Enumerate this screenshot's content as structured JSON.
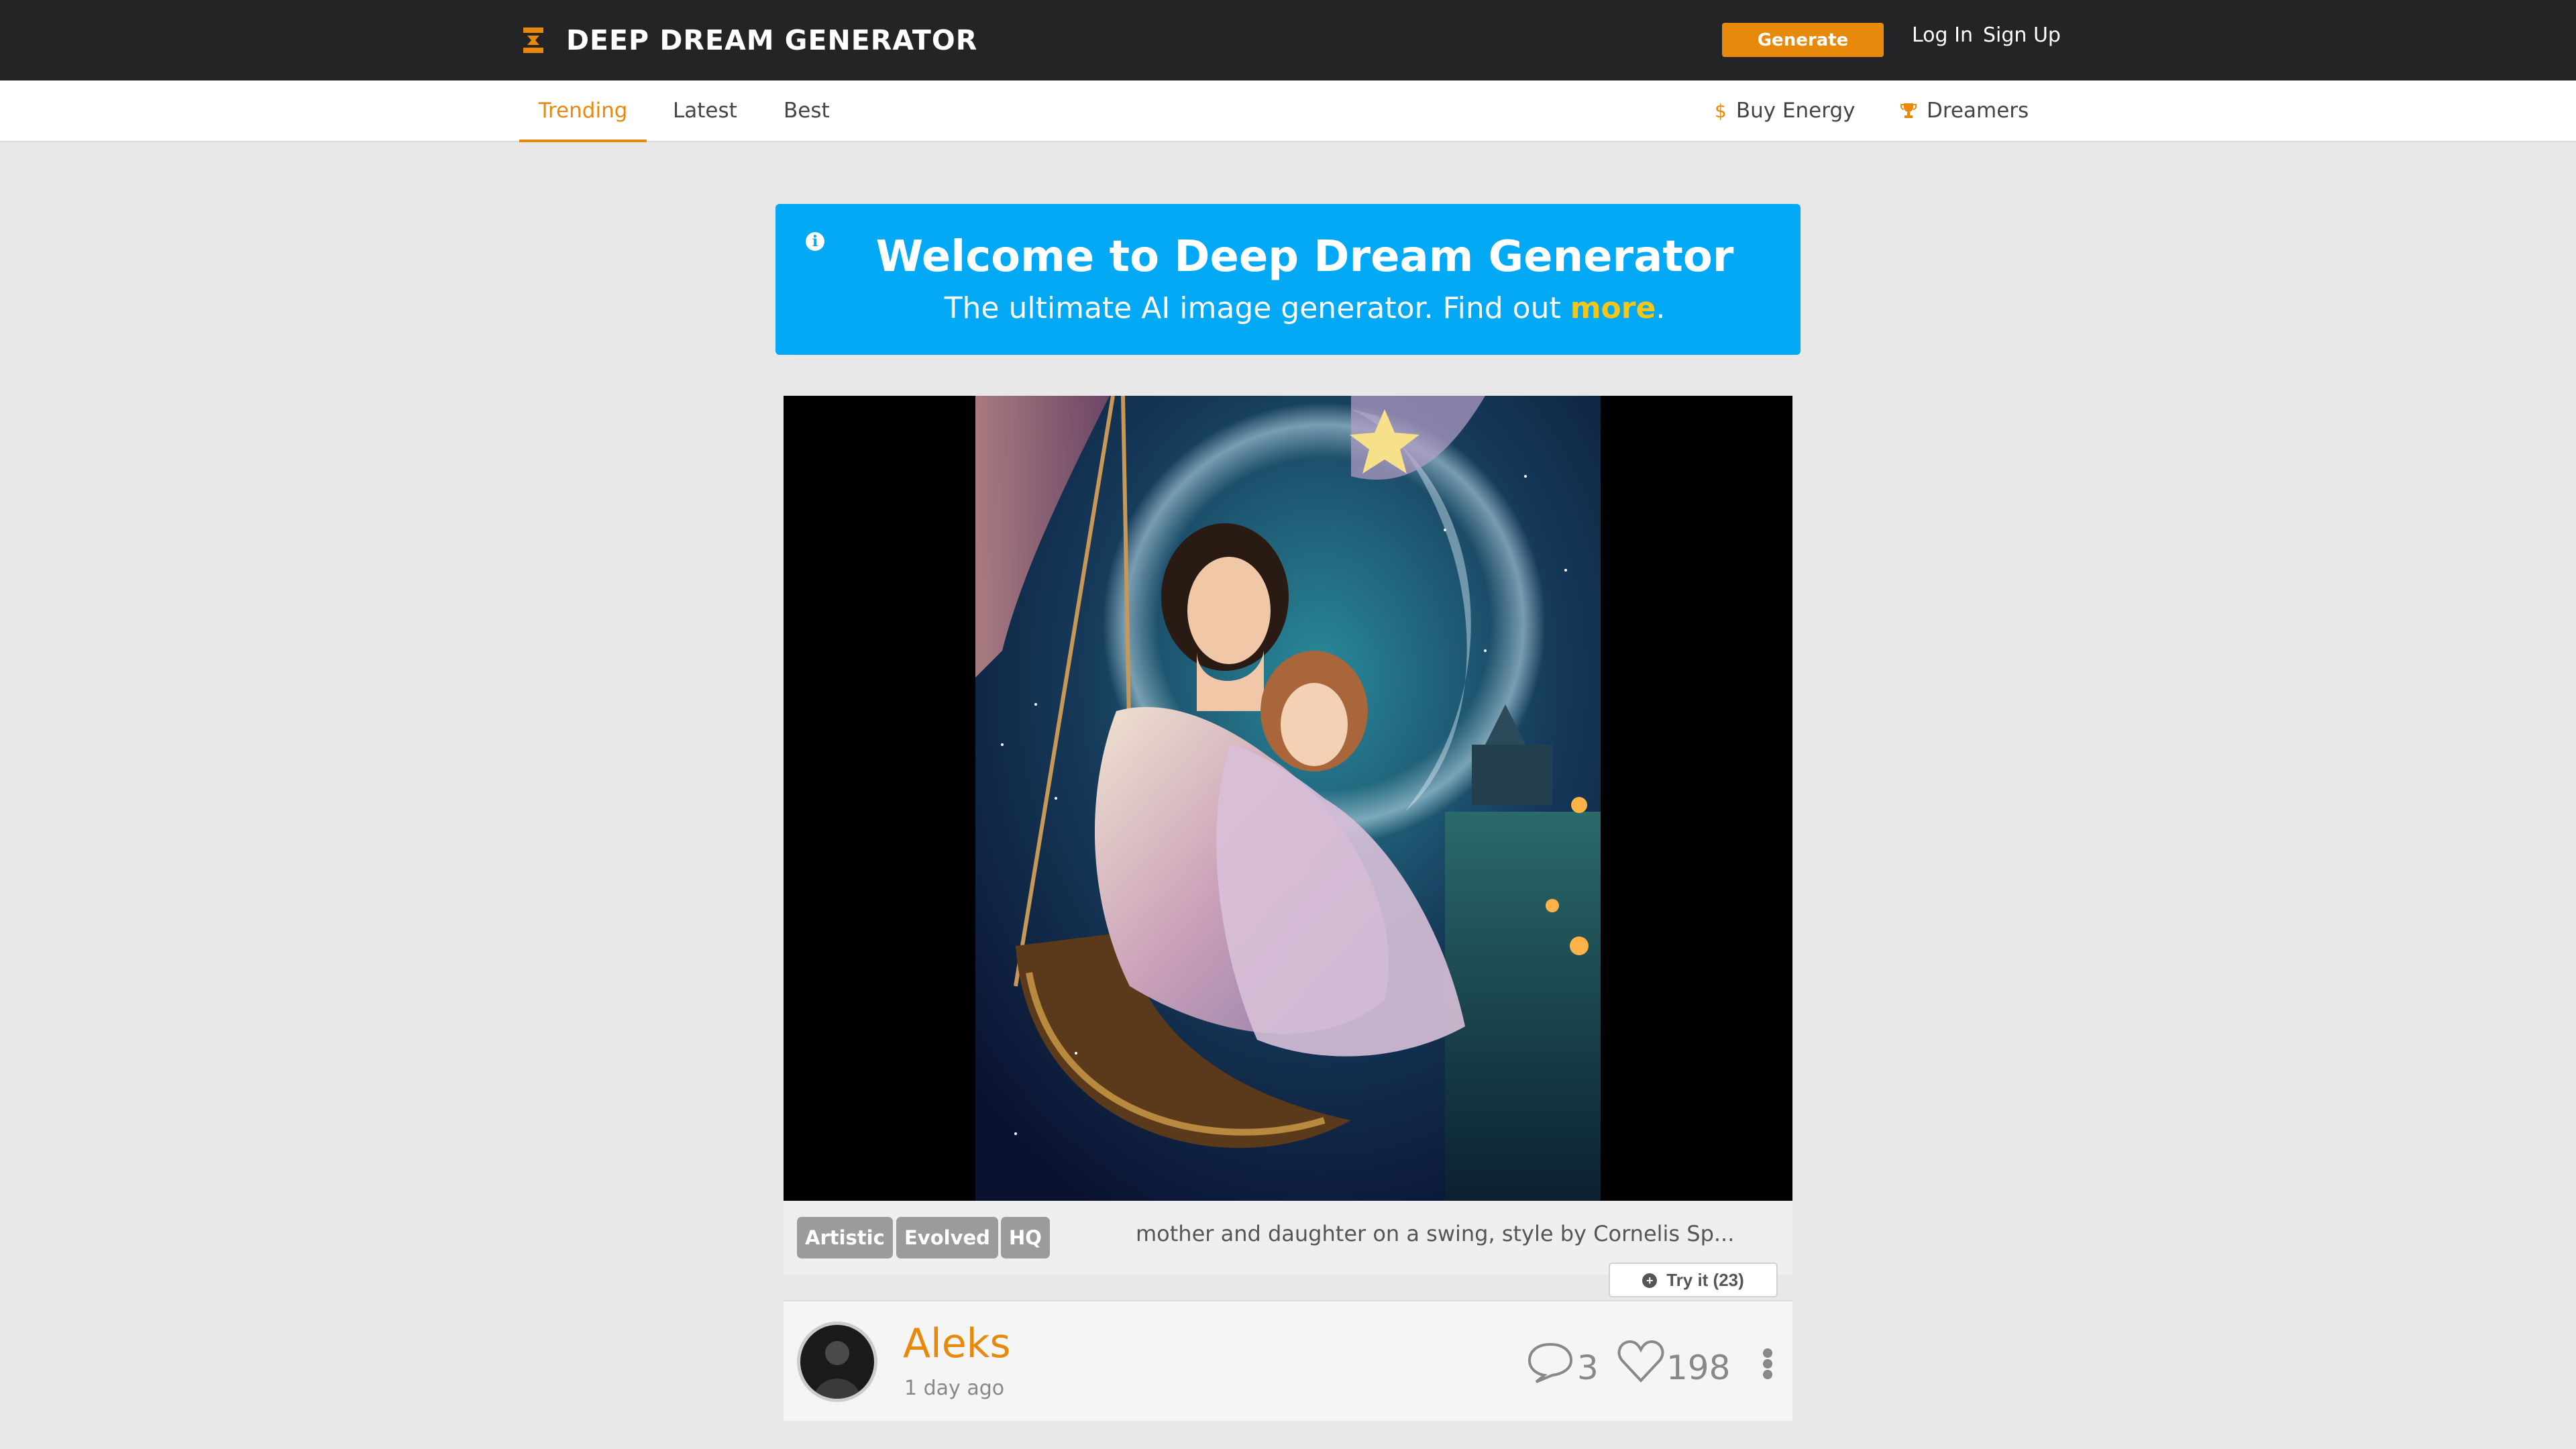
{
  "header": {
    "brand": "DEEP DREAM GENERATOR",
    "generate_label": "Generate",
    "login_label": "Log In",
    "signup_label": "Sign Up"
  },
  "subnav": {
    "tabs": [
      {
        "label": "Trending",
        "active": true
      },
      {
        "label": "Latest",
        "active": false
      },
      {
        "label": "Best",
        "active": false
      }
    ],
    "buy_energy": "Buy Energy",
    "dreamers": "Dreamers"
  },
  "banner": {
    "title": "Welcome to Deep Dream Generator",
    "subtitle_prefix": "The ultimate AI image generator. Find out ",
    "subtitle_link": "more",
    "subtitle_suffix": "."
  },
  "post": {
    "badges": [
      "Artistic",
      "Evolved",
      "HQ"
    ],
    "prompt": "mother and daughter on a swing, style by Cornelis Sp...",
    "try_it_label": "Try it (23)",
    "author": "Aleks",
    "time_ago": "1 day ago",
    "comments": "3",
    "likes": "198"
  },
  "colors": {
    "accent": "#e8890c",
    "topbar": "#242427",
    "banner": "#03a9f4",
    "highlight": "#f5c518"
  },
  "icons": [
    "logo-icon",
    "info-icon",
    "dollar-icon",
    "trophy-icon",
    "plus-circle-icon",
    "comment-icon",
    "heart-icon",
    "more-vertical-icon"
  ]
}
